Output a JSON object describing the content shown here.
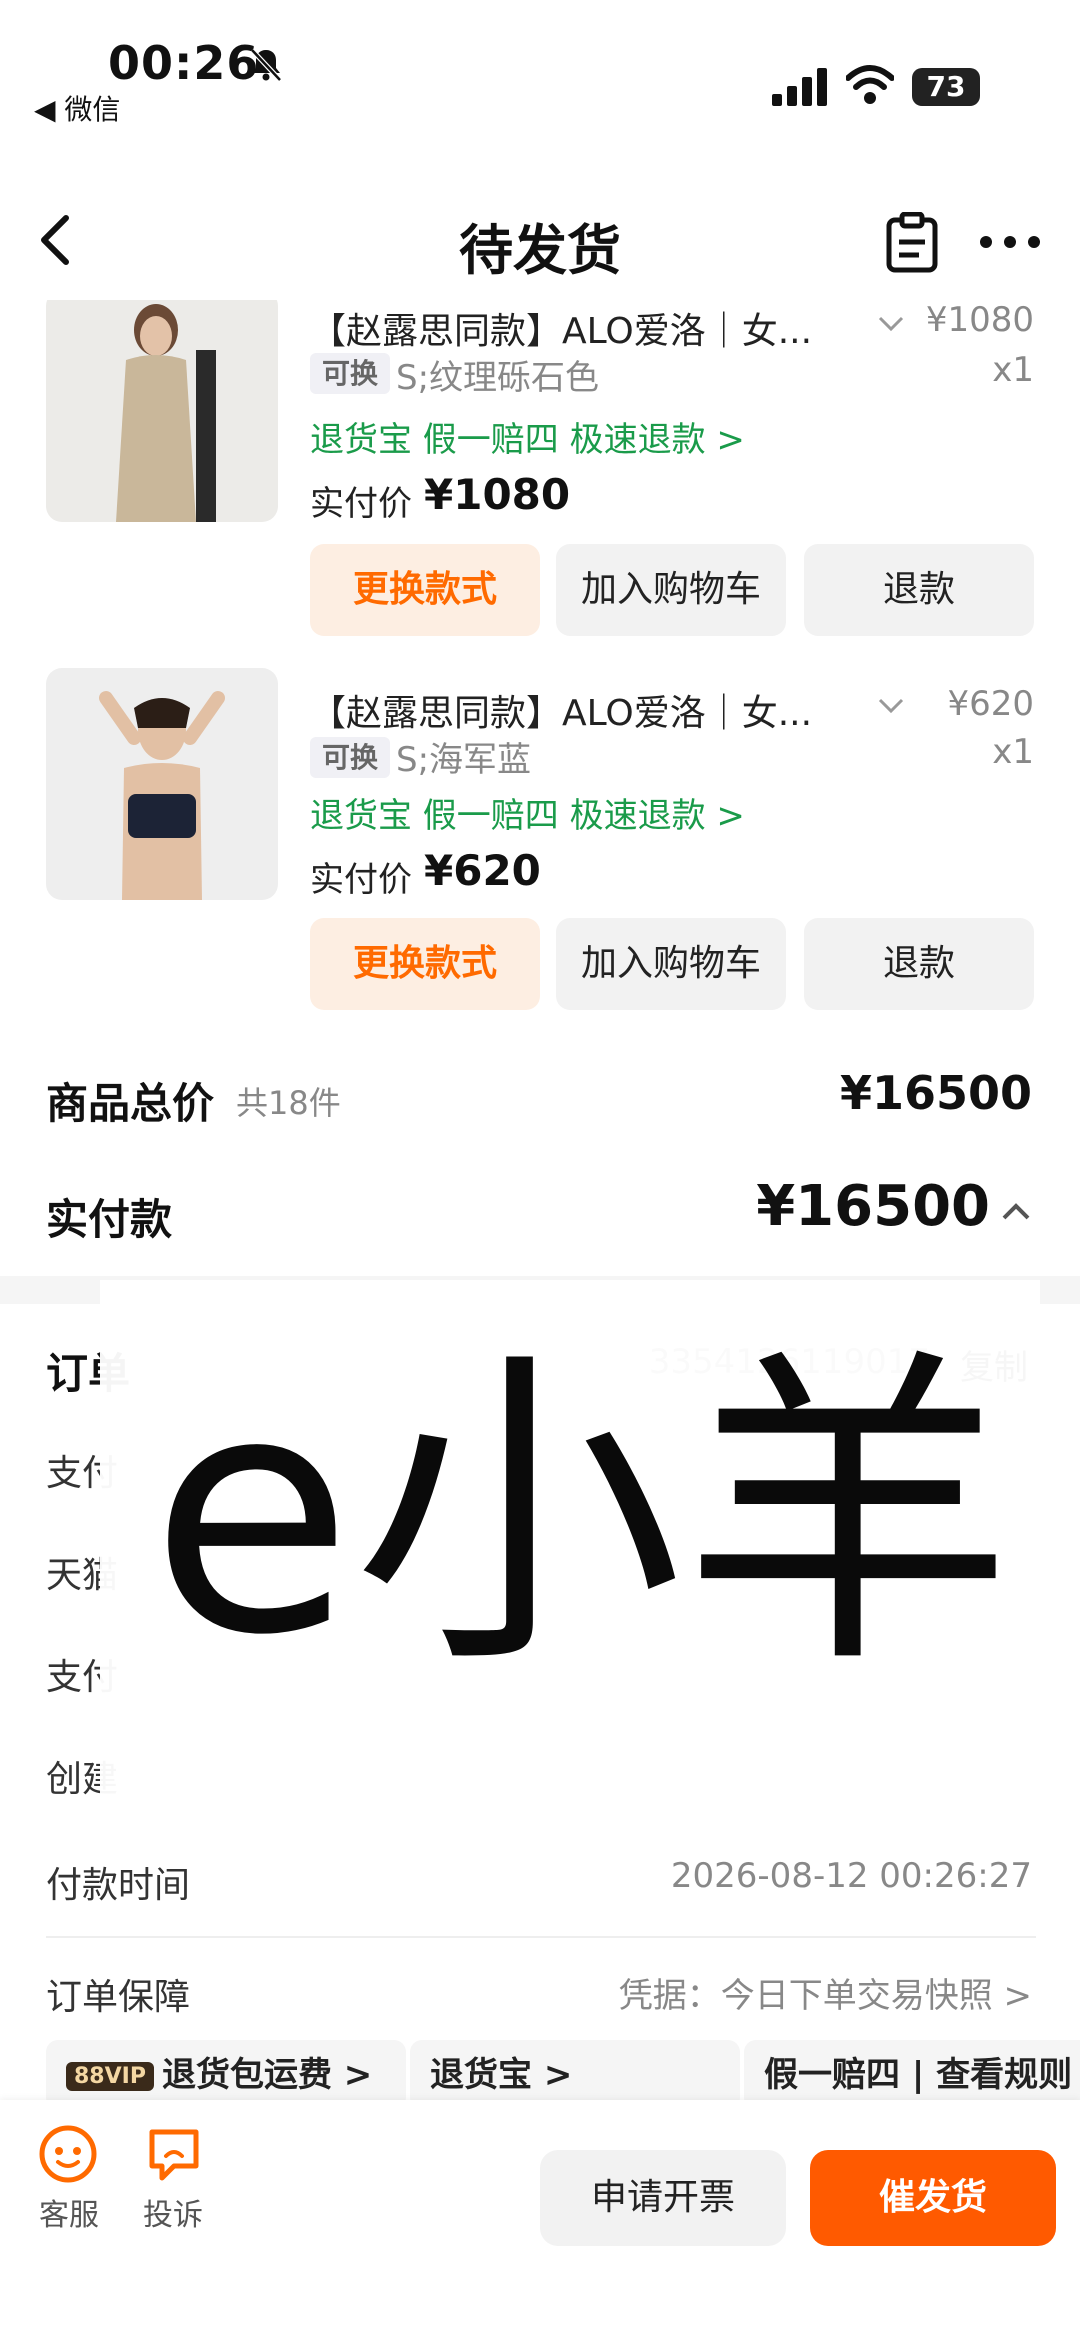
{
  "status_bar": {
    "time": "00:26",
    "back_app": "◀ 微信",
    "battery": "73"
  },
  "nav": {
    "title": "待发货"
  },
  "products": [
    {
      "title": "【赵露思同款】ALO爱洛｜女...",
      "price": "¥1080",
      "badge": "可换",
      "spec": "S;纹理砾石色",
      "qty": "x1",
      "services": "退货宝  假一赔四  极速退款 >",
      "paid_label": "实付价",
      "paid_value": "¥1080",
      "buttons": {
        "change": "更换款式",
        "cart": "加入购物车",
        "refund": "退款"
      }
    },
    {
      "title": "【赵露思同款】ALO爱洛｜女...",
      "price": "¥620",
      "badge": "可换",
      "spec": "S;海军蓝",
      "qty": "x1",
      "services": "退货宝  假一赔四  极速退款 >",
      "paid_label": "实付价",
      "paid_value": "¥620",
      "buttons": {
        "change": "更换款式",
        "cart": "加入购物车",
        "refund": "退款"
      }
    }
  ],
  "totals": {
    "goods_total_label": "商品总价",
    "goods_count": "共18件",
    "goods_total_value": "¥16500",
    "paid_label": "实付款",
    "paid_value": "¥16500"
  },
  "order_info": {
    "order_label_partial": "订单",
    "order_no_partial": "3354126119017",
    "copy": "复制",
    "row_partials": [
      "支付",
      "天猫",
      "支付",
      "创建"
    ],
    "pay_time_label": "付款时间",
    "pay_time_value": "2026-08-12 00:26:27",
    "guarantee_label": "订单保障",
    "guarantee_value": "凭据：今日下单交易快照 >"
  },
  "watermark_text": "e小羊",
  "chips": [
    {
      "badge": "88VIP",
      "label": "退货包运费 >"
    },
    {
      "badge": "",
      "label": "退货宝 >"
    },
    {
      "badge": "",
      "label": "假一赔四 | 查看规则"
    }
  ],
  "bottom_bar": {
    "service": "客服",
    "complaint": "投诉",
    "invoice": "申请开票",
    "urge": "催发货"
  },
  "colors": {
    "accent": "#ff5a00",
    "service_green": "#1a9b4a"
  }
}
